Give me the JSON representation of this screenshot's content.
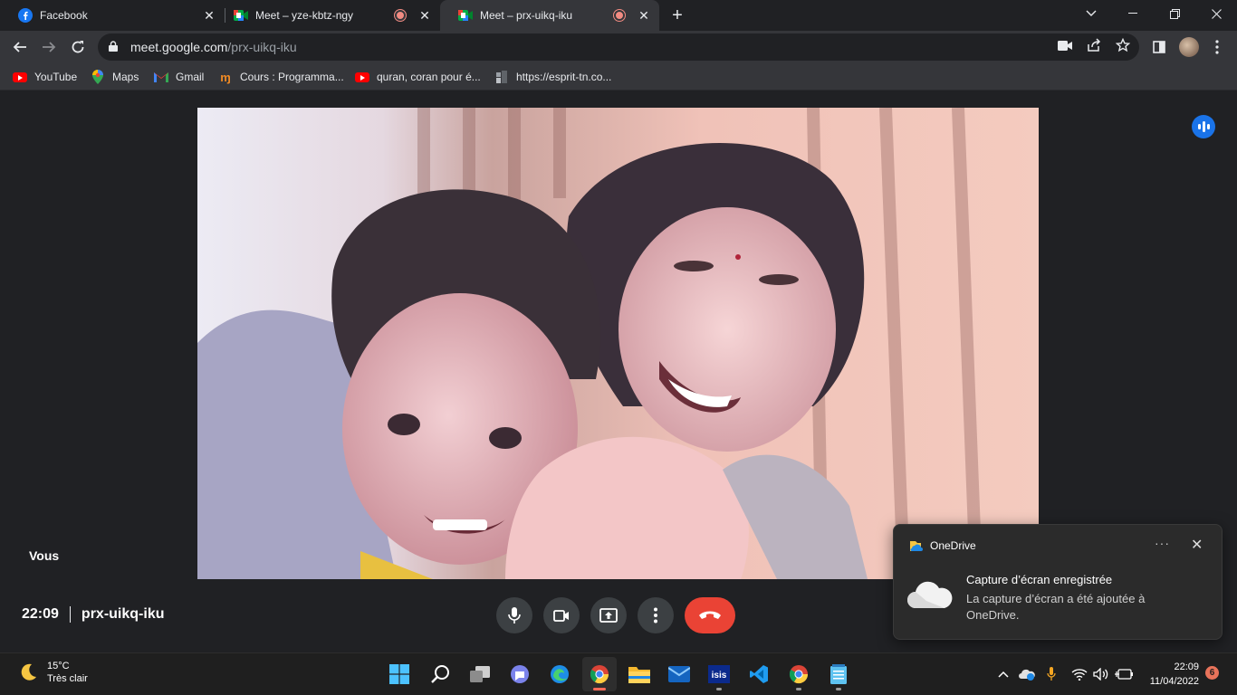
{
  "browser": {
    "tabs": [
      {
        "title": "Facebook",
        "favicon": "facebook-icon"
      },
      {
        "title": "Meet – yze-kbtz-ngy",
        "favicon": "google-meet-icon",
        "recording": true
      },
      {
        "title": "Meet – prx-uikq-iku",
        "favicon": "google-meet-icon",
        "recording": true,
        "active": true
      }
    ],
    "address": {
      "host": "meet.google.com",
      "path": "/prx-uikq-iku"
    },
    "bookmarks": [
      {
        "label": "YouTube",
        "icon": "youtube-icon"
      },
      {
        "label": "Maps",
        "icon": "maps-icon"
      },
      {
        "label": "Gmail",
        "icon": "gmail-icon"
      },
      {
        "label": "Cours : Programma...",
        "icon": "coursera-icon"
      },
      {
        "label": "quran, coran pour é...",
        "icon": "youtube-icon"
      },
      {
        "label": "https://esprit-tn.co...",
        "icon": "site-icon"
      }
    ]
  },
  "meet": {
    "self_label": "Vous",
    "time": "22:09",
    "meeting_code": "prx-uikq-iku",
    "accent": "#1a73e8",
    "end_color": "#ea4335"
  },
  "toast": {
    "app": "OneDrive",
    "title": "Capture d’écran enregistrée",
    "body": "La capture d’écran a été ajoutée à OneDrive."
  },
  "taskbar": {
    "weather": {
      "temp": "15°C",
      "desc": "Très clair"
    },
    "clock": {
      "time": "22:09",
      "date": "11/04/2022"
    },
    "notifications": "6"
  }
}
